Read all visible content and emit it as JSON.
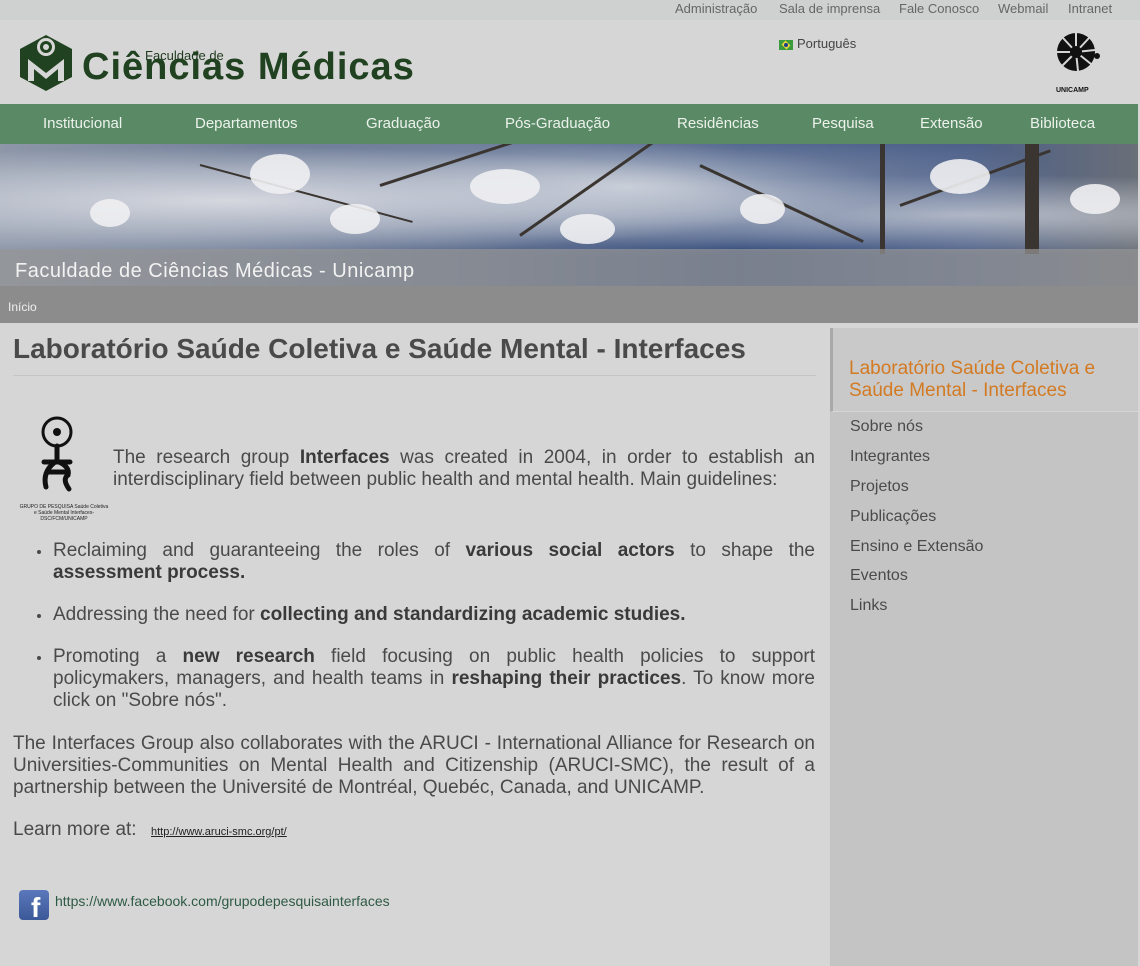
{
  "top_links": [
    "Administração",
    "Sala de imprensa",
    "Fale Conosco",
    "Webmail",
    "Intranet"
  ],
  "header": {
    "logo_small": "Faculdade de",
    "logo_big": "Ciências Médicas",
    "language": "Português",
    "unicamp_label": "UNICAMP"
  },
  "nav": [
    "Institucional",
    "Departamentos",
    "Graduação",
    "Pós-Graduação",
    "Residências",
    "Pesquisa",
    "Extensão",
    "Biblioteca"
  ],
  "banner": {
    "title": "Faculdade de Ciências Médicas - Unicamp"
  },
  "breadcrumb": "Início",
  "main": {
    "title": "Laboratório Saúde Coletiva e Saúde Mental - Interfaces",
    "logo_text": "GRUPO DE PESQUISA Saúde Coletiva e Saúde Mental Interfaces-DSC/FCM/UNICAMP",
    "intro": {
      "t1": "The research group ",
      "b1": "Interfaces",
      "t2": " was created in 2004, in order to establish an interdisciplinary field between public health and mental health. Main guidelines:"
    },
    "bullets": [
      {
        "t1": "Reclaiming and guaranteeing the roles of ",
        "b1": "various social actors",
        "t2": " to shape the ",
        "b2": "assessment process.",
        "t3": ""
      },
      {
        "t1": "Addressing the need for ",
        "b1": "collecting and standardizing academic studies.",
        "t2": "",
        "b2": "",
        "t3": ""
      },
      {
        "t1": "Promoting a ",
        "b1": "new research",
        "t2": " field focusing on public health policies to support policymakers, managers, and health teams in ",
        "b2": "reshaping their practices",
        "t3": ". To know more click on \"Sobre nós\"."
      }
    ],
    "aruci": "The Interfaces Group also collaborates with the ARUCI - International Alliance for Research on Universities-Communities on Mental Health and Citizenship (ARUCI-SMC), the result of a partnership between the Université de Montréal, Quebéc, Canada, and UNICAMP.",
    "learn_more": "Learn more at:",
    "learn_link": "http://www.aruci-smc.org/pt/",
    "facebook_link": "https://www.facebook.com/grupodepesquisainterfaces"
  },
  "sidebar": {
    "heading": "Laboratório Saúde Coletiva e Saúde Mental - Interfaces",
    "items": [
      "Sobre nós",
      "Integrantes",
      "Projetos",
      "Publicações",
      "Ensino e Extensão",
      "Eventos",
      "Links"
    ]
  },
  "colors": {
    "nav_bg": "#5a8a65",
    "sidebar_heading": "#d37a22",
    "logo_green": "#214221"
  }
}
